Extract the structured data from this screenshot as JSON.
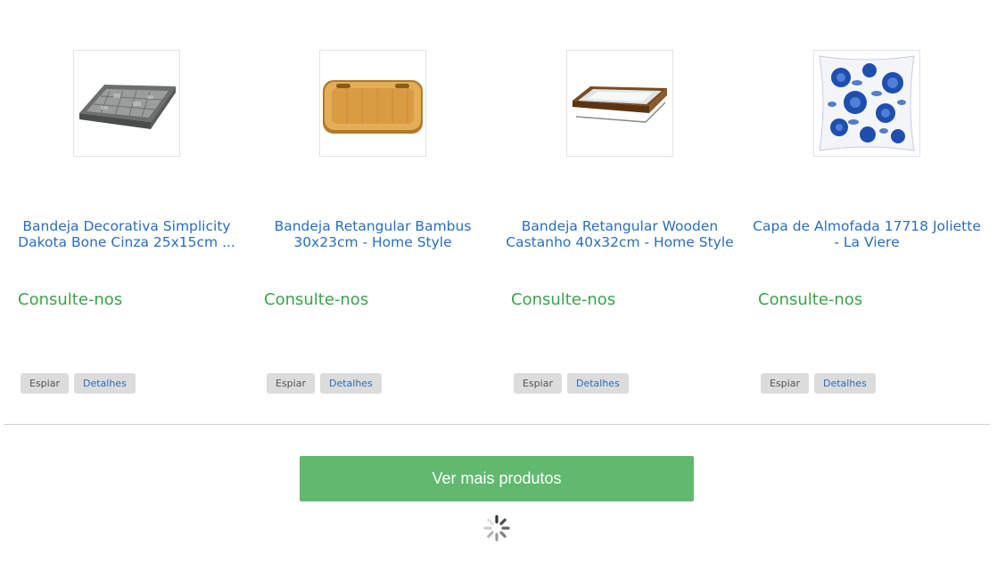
{
  "products": [
    {
      "title": "Bandeja Decorativa Simplicity Dakota Bone Cinza 25x15cm ...",
      "price": "Consulte-nos",
      "image_icon": "gray-tray-image"
    },
    {
      "title": "Bandeja Retangular Bambus 30x23cm - Home Style",
      "price": "Consulte-nos",
      "image_icon": "bamboo-tray-image"
    },
    {
      "title": "Bandeja Retangular Wooden Castanho 40x32cm - Home Style",
      "price": "Consulte-nos",
      "image_icon": "wooden-mirror-tray-image"
    },
    {
      "title": "Capa de Almofada 17718 Joliette - La Viere",
      "price": "Consulte-nos",
      "image_icon": "floral-cushion-image"
    }
  ],
  "buttons": {
    "espiar": "Espiar",
    "detalhes": "Detalhes"
  },
  "load_more": {
    "label": "Ver mais produtos"
  },
  "colors": {
    "link": "#2a6ebb",
    "price": "#3ca24c",
    "load_more_bg": "#61b96e",
    "small_button_bg": "#dcdcdc"
  }
}
